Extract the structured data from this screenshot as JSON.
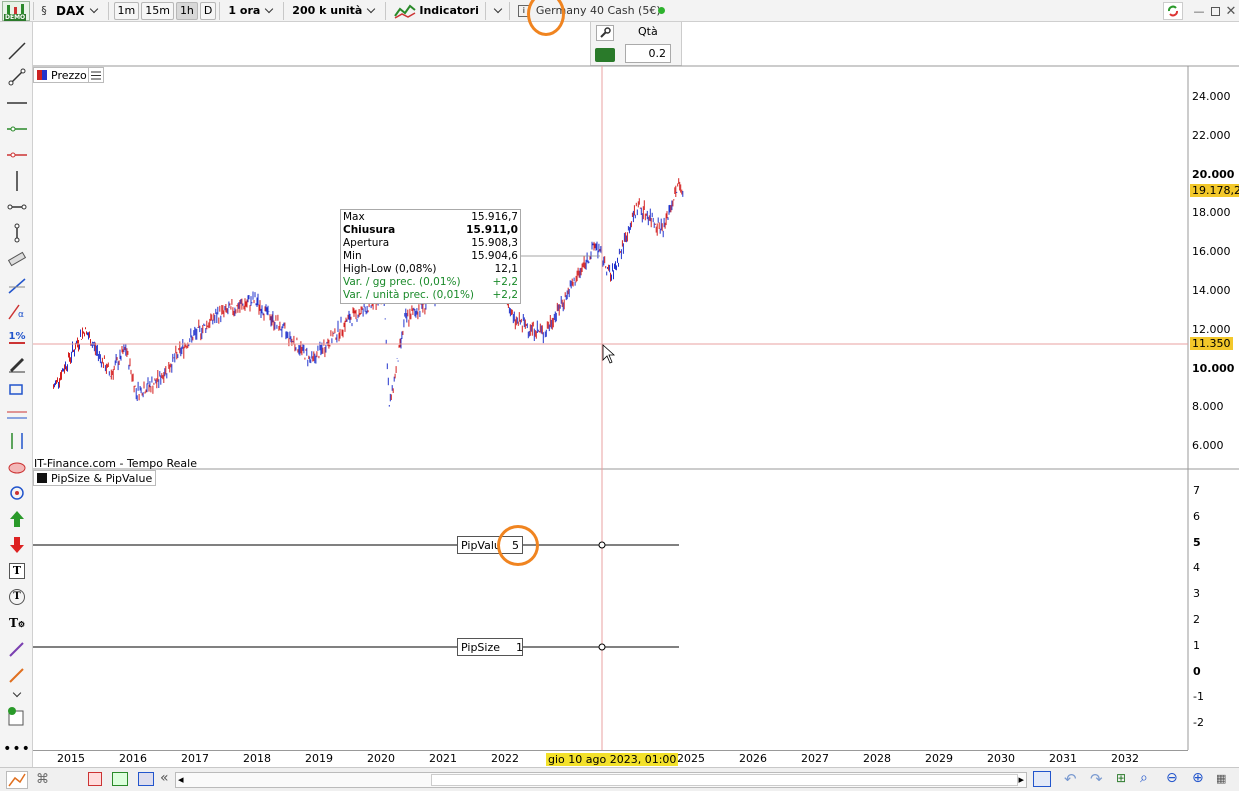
{
  "topbar": {
    "demo_badge": "DEMO",
    "symbol": "DAX",
    "timeframes": [
      "1m",
      "15m",
      "1h",
      "D"
    ],
    "active_timeframe": "1h",
    "interval": "1 ora",
    "units": "200 k unità",
    "indicators": "Indicatori",
    "instrument": "Germany 40 Cash (5€)"
  },
  "trade_panel": {
    "qty_label": "Qtà",
    "qty_value": "0.2"
  },
  "price_panel": {
    "legend": "Prezzo",
    "source": "IT-Finance.com - Tempo Reale",
    "y_ticks": [
      "24.000",
      "22.000",
      "20.000",
      "18.000",
      "16.000",
      "14.000",
      "12.000",
      "10.000",
      "8.000",
      "6.000"
    ],
    "last_price": "19.178,2",
    "cursor_price": "11.350",
    "tooltip": [
      {
        "label": "Max",
        "value": "15.916,7",
        "style": "normal"
      },
      {
        "label": "Chiusura",
        "value": "15.911,0",
        "style": "bold"
      },
      {
        "label": "Apertura",
        "value": "15.908,3",
        "style": "normal"
      },
      {
        "label": "Min",
        "value": "15.904,6",
        "style": "normal"
      },
      {
        "label": "High-Low (0,08%)",
        "value": "12,1",
        "style": "normal"
      },
      {
        "label": "Var. / gg prec. (0,01%)",
        "value": "+2,2",
        "style": "green"
      },
      {
        "label": "Var. / unità prec. (0,01%)",
        "value": "+2,2",
        "style": "green"
      }
    ]
  },
  "indicator_panel": {
    "legend": "PipSize & PipValue",
    "y_ticks": [
      "7",
      "6",
      "5",
      "4",
      "3",
      "2",
      "1",
      "0",
      "-1",
      "-2"
    ],
    "pipvalue_label": "PipValue",
    "pipvalue": "5",
    "pipsize_label": "PipSize",
    "pipsize": "1"
  },
  "x_axis": {
    "years": [
      "2015",
      "2016",
      "2017",
      "2018",
      "2019",
      "2020",
      "2021",
      "2022",
      "2023",
      "2024",
      "2025",
      "2026",
      "2027",
      "2028",
      "2029",
      "2030",
      "2031",
      "2032"
    ],
    "cursor_date": "gio 10 ago 2023, 01:00"
  },
  "chart_data": {
    "type": "line",
    "title": "",
    "xlabel": "",
    "ylabel": "",
    "series": [
      {
        "values": [
          {
            "x": "2014-10",
            "y": 9000
          },
          {
            "x": "2015-04",
            "y": 12000
          },
          {
            "x": "2015-09",
            "y": 9700
          },
          {
            "x": "2015-12",
            "y": 11000
          },
          {
            "x": "2016-02",
            "y": 8800
          },
          {
            "x": "2016-06",
            "y": 9300
          },
          {
            "x": "2016-12",
            "y": 11400
          },
          {
            "x": "2017-06",
            "y": 12800
          },
          {
            "x": "2018-01",
            "y": 13500
          },
          {
            "x": "2018-12",
            "y": 10400
          },
          {
            "x": "2019-07",
            "y": 12500
          },
          {
            "x": "2020-02",
            "y": 13700
          },
          {
            "x": "2020-03",
            "y": 8000
          },
          {
            "x": "2020-06",
            "y": 12500
          },
          {
            "x": "2021-01",
            "y": 14000
          },
          {
            "x": "2021-11",
            "y": 16200
          },
          {
            "x": "2022-03",
            "y": 12500
          },
          {
            "x": "2022-09",
            "y": 11800
          },
          {
            "x": "2023-07",
            "y": 16400
          },
          {
            "x": "2023-10",
            "y": 14700
          },
          {
            "x": "2024-03",
            "y": 18400
          },
          {
            "x": "2024-08",
            "y": 17200
          },
          {
            "x": "2024-11",
            "y": 19500
          },
          {
            "x": "2024-12",
            "y": 19178
          }
        ]
      }
    ],
    "ylim": [
      6000,
      24000
    ]
  }
}
